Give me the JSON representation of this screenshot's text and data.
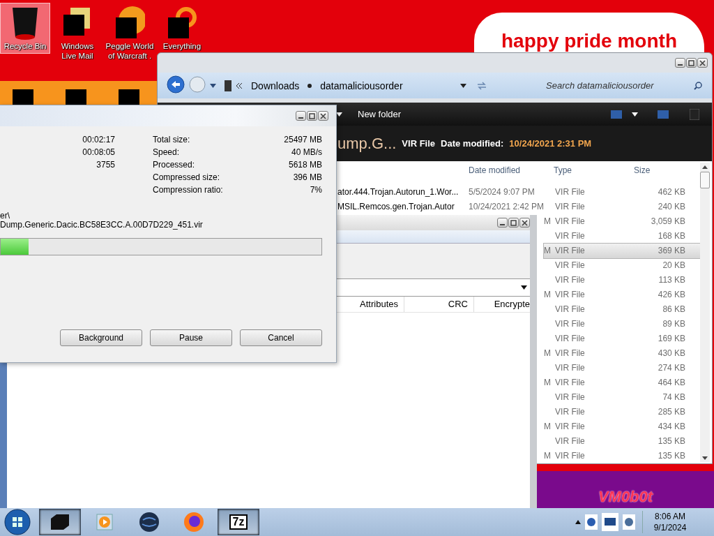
{
  "desktop": {
    "icons": [
      {
        "label": "Recycle Bin",
        "kind": "bin",
        "selected": true
      },
      {
        "label": "Windows Live Mail",
        "kind": "mail",
        "selected": false
      },
      {
        "label": "Peggle World of Warcraft .",
        "kind": "peggle",
        "selected": false
      },
      {
        "label": "Everything",
        "kind": "ring",
        "selected": false
      }
    ],
    "banner": "happy pride month",
    "badge": "VM0b0t"
  },
  "explorer": {
    "breadcrumb": [
      "Downloads",
      "datamaliciousorder"
    ],
    "search": {
      "placeholder": "Search datamaliciousorder"
    },
    "toolbar": {
      "new_folder": "New folder"
    },
    "details": {
      "name": "ump.G...",
      "type": "VIR File",
      "date_label": "Date modified:",
      "date": "10/24/2021 2:31 PM"
    },
    "columns": [
      "Date modified",
      "Type",
      "Size"
    ],
    "rows": [
      {
        "name": "ator.444.Trojan.Autorun_1.Wor...",
        "date": "5/5/2024 9:07 PM",
        "type": "VIR File",
        "size": "462 KB",
        "selected": false
      },
      {
        "name": "MSIL.Remcos.gen.Trojan.Autor",
        "date": "10/24/2021 2:42 PM",
        "type": "VIR File",
        "size": "240 KB",
        "selected": false
      },
      {
        "date": "M",
        "date_clipped": true,
        "type": "VIR File",
        "size": "3,059 KB",
        "selected": false
      },
      {
        "type": "VIR File",
        "size": "168 KB",
        "selected": false
      },
      {
        "date": "M",
        "date_clipped": true,
        "type": "VIR File",
        "size": "369 KB",
        "selected": true
      },
      {
        "type": "VIR File",
        "size": "20 KB",
        "selected": false
      },
      {
        "type": "VIR File",
        "size": "113 KB",
        "selected": false
      },
      {
        "date": "M",
        "date_clipped": true,
        "type": "VIR File",
        "size": "426 KB",
        "selected": false
      },
      {
        "type": "VIR File",
        "size": "86 KB",
        "selected": false
      },
      {
        "type": "VIR File",
        "size": "89 KB",
        "selected": false
      },
      {
        "type": "VIR File",
        "size": "169 KB",
        "selected": false
      },
      {
        "date": "M",
        "date_clipped": true,
        "type": "VIR File",
        "size": "430 KB",
        "selected": false
      },
      {
        "type": "VIR File",
        "size": "274 KB",
        "selected": false
      },
      {
        "date": "M",
        "date_clipped": true,
        "type": "VIR File",
        "size": "464 KB",
        "selected": false
      },
      {
        "type": "VIR File",
        "size": "74 KB",
        "selected": false
      },
      {
        "type": "VIR File",
        "size": "285 KB",
        "selected": false
      },
      {
        "date": "M",
        "date_clipped": true,
        "type": "VIR File",
        "size": "434 KB",
        "selected": false
      },
      {
        "type": "VIR File",
        "size": "135 KB",
        "selected": false
      },
      {
        "date": "M",
        "date_clipped": true,
        "type": "VIR File",
        "size": "135 KB",
        "selected": false
      }
    ]
  },
  "archive_window": {
    "columns": [
      "Attributes",
      "CRC",
      "Encrypte"
    ]
  },
  "progress_dialog": {
    "left_values": [
      "00:02:17",
      "00:08:05",
      "3755"
    ],
    "stats": [
      {
        "label": "Total size:",
        "value": "25497 MB"
      },
      {
        "label": "Speed:",
        "value": "40 MB/s"
      },
      {
        "label": "Processed:",
        "value": "5618 MB"
      },
      {
        "label": "Compressed size:",
        "value": "396 MB"
      },
      {
        "label": "Compression ratio:",
        "value": "7%"
      }
    ],
    "path_lines": [
      "er\\",
      "Dump.Generic.Dacic.BC58E3CC.A.00D7D229_451.vir"
    ],
    "level": 0.087,
    "buttons": [
      "Background",
      "Pause",
      "Cancel"
    ]
  },
  "taskbar": {
    "apps": [
      {
        "kind": "box",
        "active": true
      },
      {
        "kind": "media",
        "active": false
      },
      {
        "kind": "globe",
        "active": false
      },
      {
        "kind": "firefox",
        "active": false
      },
      {
        "kind": "sevenzip",
        "label": "7z",
        "active": true
      }
    ],
    "clock": {
      "time": "8:06 AM",
      "date": "9/1/2024"
    }
  }
}
